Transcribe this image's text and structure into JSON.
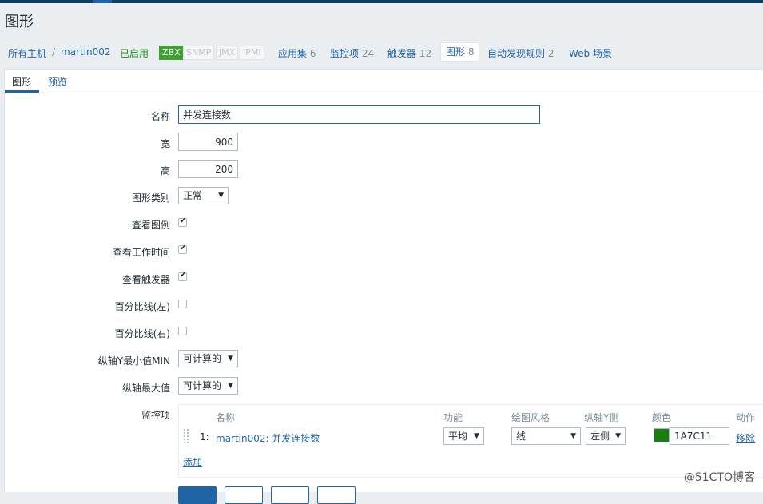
{
  "header": {
    "title": "图形"
  },
  "breadcrumb": {
    "all_hosts": "所有主机",
    "separator": "/",
    "host": "martin002",
    "status": "已启用",
    "tags": [
      "ZBX",
      "SNMP",
      "JMX",
      "IPMI"
    ],
    "apps_label": "应用集",
    "apps_count": "6",
    "items_label": "监控项",
    "items_count": "24",
    "triggers_label": "触发器",
    "triggers_count": "12",
    "graphs_label": "图形",
    "graphs_count": "8",
    "discovery_label": "自动发现规则",
    "discovery_count": "2",
    "web_label": "Web 场景"
  },
  "tabs": {
    "graph": "图形",
    "preview": "预览"
  },
  "form": {
    "name_label": "名称",
    "name_value": "并发连接数",
    "width_label": "宽",
    "width_value": "900",
    "height_label": "高",
    "height_value": "200",
    "graph_type_label": "图形类别",
    "graph_type_value": "正常",
    "show_legend_label": "查看图例",
    "show_legend": true,
    "show_worktime_label": "查看工作时间",
    "show_worktime": true,
    "show_triggers_label": "查看触发器",
    "show_triggers": true,
    "percentile_left_label": "百分比线(左)",
    "percentile_left": false,
    "percentile_right_label": "百分比线(右)",
    "percentile_right": false,
    "ymin_label": "纵轴Y最小值MIN",
    "ymin_value": "可计算的",
    "ymax_label": "纵轴最大值",
    "ymax_value": "可计算的",
    "items_label": "监控项"
  },
  "items_table": {
    "headers": {
      "name": "名称",
      "function": "功能",
      "draw_style": "绘图风格",
      "y_axis_side": "纵轴Y侧",
      "color": "颜色",
      "action": "动作"
    },
    "rows": [
      {
        "index": "1:",
        "name": "martin002: 并发连接数",
        "function": "平均",
        "draw_style": "线",
        "y_axis_side": "左侧",
        "color_hex": "#1A7C11",
        "color_text": "1A7C11",
        "action": "移除"
      }
    ],
    "add_link": "添加"
  },
  "watermark": "@51CTO博客",
  "colors": {
    "accent": "#1f65a6",
    "status_green": "#1b8d1b",
    "zbx_green": "#40a033"
  }
}
